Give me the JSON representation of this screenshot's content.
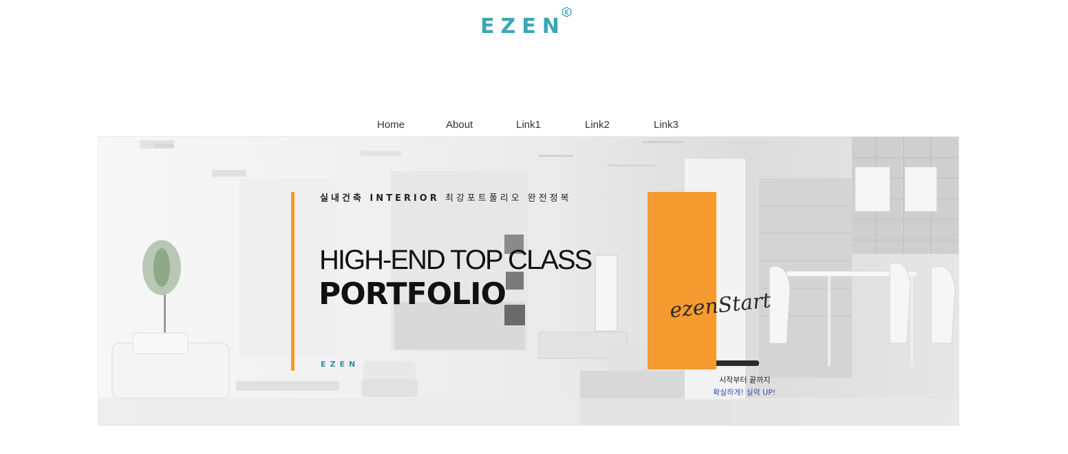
{
  "logo": {
    "text": "EZEN",
    "badge": "E",
    "color": "#3aa6b8"
  },
  "nav": {
    "items": [
      {
        "label": "Home"
      },
      {
        "label": "About"
      },
      {
        "label": "Link1"
      },
      {
        "label": "Link2"
      },
      {
        "label": "Link3"
      }
    ]
  },
  "hero": {
    "subtitle_bold": "실내건축 INTERIOR",
    "subtitle_rest": " 최강포트폴리오 완전정복",
    "headline": "HIGH-END TOP CLASS",
    "headline_bold": "PORTFOLIO",
    "brand": "EZEN",
    "signature": "ezenStart",
    "card_line_1": "시작부터 끝까지",
    "card_line_2": "확실하게! 실력 UP!",
    "accent_color": "#f39a2f"
  }
}
